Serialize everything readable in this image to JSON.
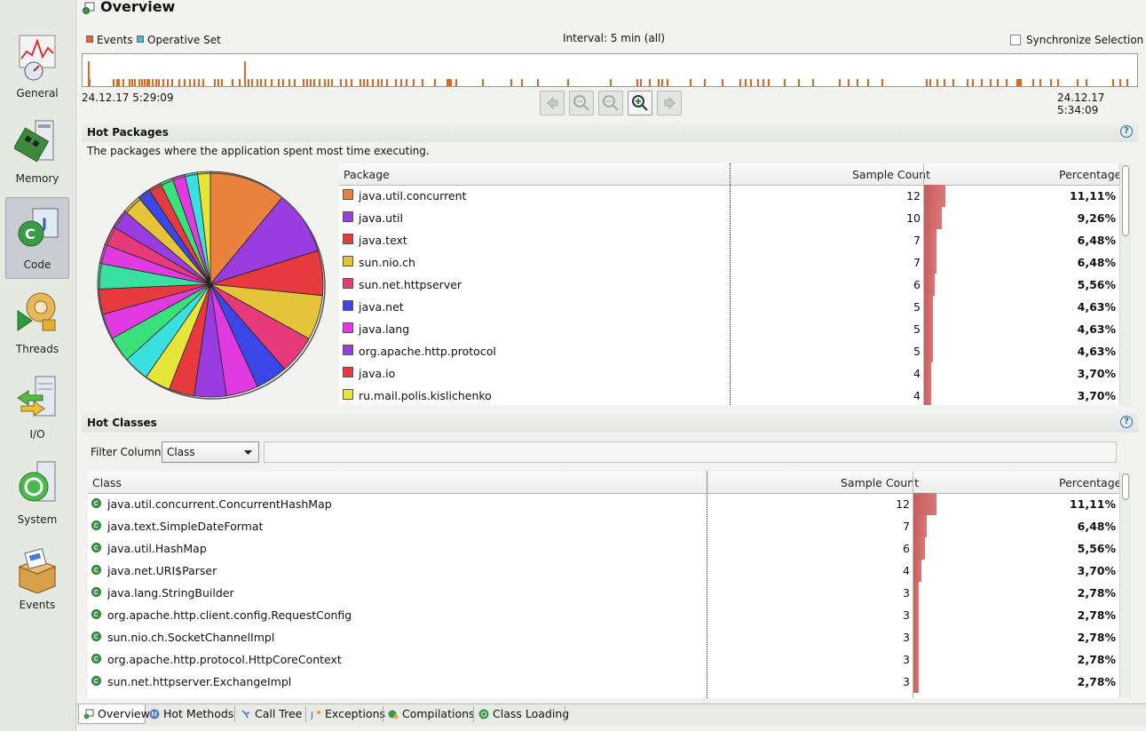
{
  "sidebar": {
    "items": [
      {
        "label": "General",
        "icon": "general-chart-icon"
      },
      {
        "label": "Memory",
        "icon": "memory-chip-icon"
      },
      {
        "label": "Code",
        "icon": "code-class-icon",
        "active": true
      },
      {
        "label": "Threads",
        "icon": "threads-gear-icon"
      },
      {
        "label": "I/O",
        "icon": "io-server-icon"
      },
      {
        "label": "System",
        "icon": "system-server-icon"
      },
      {
        "label": "Events",
        "icon": "events-box-icon"
      }
    ]
  },
  "header": {
    "title": "Overview"
  },
  "timeline": {
    "legend_events": "Events",
    "legend_operative": "Operative Set",
    "interval": "Interval: 5 min (all)",
    "sync_label": "Synchronize Selection",
    "sync_checked": false,
    "start_time": "24.12.17 5:29:09",
    "end_time": "24.12.17 5:34:09",
    "colors": {
      "events": "#e8651a",
      "operative": "#4ab3e6"
    }
  },
  "hot_packages": {
    "title": "Hot Packages",
    "description": "The packages where the application spent most time executing.",
    "columns": [
      "Package",
      "Sample Count",
      "Percentage"
    ],
    "rows": [
      {
        "name": "java.util.concurrent",
        "count": "12",
        "pct": "11,11%",
        "color": "#e8823c",
        "value": 11.11
      },
      {
        "name": "java.util",
        "count": "10",
        "pct": "9,26%",
        "color": "#9a3de0",
        "value": 9.26
      },
      {
        "name": "java.text",
        "count": "7",
        "pct": "6,48%",
        "color": "#e63a3f",
        "value": 6.48
      },
      {
        "name": "sun.nio.ch",
        "count": "7",
        "pct": "6,48%",
        "color": "#e6c43a",
        "value": 6.48
      },
      {
        "name": "sun.net.httpserver",
        "count": "6",
        "pct": "5,56%",
        "color": "#e63a7a",
        "value": 5.56
      },
      {
        "name": "java.net",
        "count": "5",
        "pct": "4,63%",
        "color": "#3a46e6",
        "value": 4.63
      },
      {
        "name": "java.lang",
        "count": "5",
        "pct": "4,63%",
        "color": "#e03ae0",
        "value": 4.63
      },
      {
        "name": "org.apache.http.protocol",
        "count": "5",
        "pct": "4,63%",
        "color": "#9a3de0",
        "value": 4.63
      },
      {
        "name": "java.io",
        "count": "4",
        "pct": "3,70%",
        "color": "#e63a3f",
        "value": 3.7
      },
      {
        "name": "ru.mail.polis.kislichenko",
        "count": "4",
        "pct": "3,70%",
        "color": "#e6e63a",
        "value": 3.7
      }
    ]
  },
  "hot_classes": {
    "title": "Hot Classes",
    "filter_label": "Filter Column",
    "filter_value": "Class",
    "columns": [
      "Class",
      "Sample Count",
      "Percentage"
    ],
    "rows": [
      {
        "name": "java.util.concurrent.ConcurrentHashMap",
        "count": "12",
        "pct": "11,11%",
        "value": 11.11
      },
      {
        "name": "java.text.SimpleDateFormat",
        "count": "7",
        "pct": "6,48%",
        "value": 6.48
      },
      {
        "name": "java.util.HashMap",
        "count": "6",
        "pct": "5,56%",
        "value": 5.56
      },
      {
        "name": "java.net.URI$Parser",
        "count": "4",
        "pct": "3,70%",
        "value": 3.7
      },
      {
        "name": "java.lang.StringBuilder",
        "count": "3",
        "pct": "2,78%",
        "value": 2.78
      },
      {
        "name": "org.apache.http.client.config.RequestConfig",
        "count": "3",
        "pct": "2,78%",
        "value": 2.78
      },
      {
        "name": "sun.nio.ch.SocketChannelImpl",
        "count": "3",
        "pct": "2,78%",
        "value": 2.78
      },
      {
        "name": "org.apache.http.protocol.HttpCoreContext",
        "count": "3",
        "pct": "2,78%",
        "value": 2.78
      },
      {
        "name": "sun.net.httpserver.ExchangeImpl",
        "count": "3",
        "pct": "2,78%",
        "value": 2.78
      }
    ]
  },
  "pie": {
    "colors": [
      "#e8823c",
      "#9a3de0",
      "#e63a3f",
      "#e6c43a",
      "#e63a7a",
      "#3a46e6",
      "#e03ae0",
      "#9a3de0",
      "#e63a3f",
      "#e6e63a",
      "#3ae0e0",
      "#3ae07a",
      "#e03ae0",
      "#e63a3f",
      "#3ae0a0",
      "#e03ae0",
      "#e63a7a",
      "#9a3de0",
      "#e6c43a",
      "#3a46e6",
      "#e63a3f",
      "#3ae07a",
      "#e03ae0",
      "#3ae0e0",
      "#e6e63a"
    ],
    "values": [
      11.11,
      9.26,
      6.48,
      6.48,
      5.56,
      4.63,
      4.63,
      4.63,
      3.7,
      3.7,
      3.7,
      3.7,
      3.7,
      3.7,
      3.7,
      2.78,
      2.78,
      2.78,
      2.78,
      1.85,
      1.85,
      1.85,
      1.85,
      1.85,
      1.85
    ]
  },
  "tabs": [
    {
      "label": "Overview",
      "icon": "overview-icon",
      "active": true
    },
    {
      "label": "Hot Methods",
      "icon": "hot-methods-icon"
    },
    {
      "label": "Call Tree",
      "icon": "call-tree-icon"
    },
    {
      "label": "Exceptions",
      "icon": "exceptions-icon"
    },
    {
      "label": "Compilations",
      "icon": "compilations-icon"
    },
    {
      "label": "Class Loading",
      "icon": "class-loading-icon"
    }
  ]
}
